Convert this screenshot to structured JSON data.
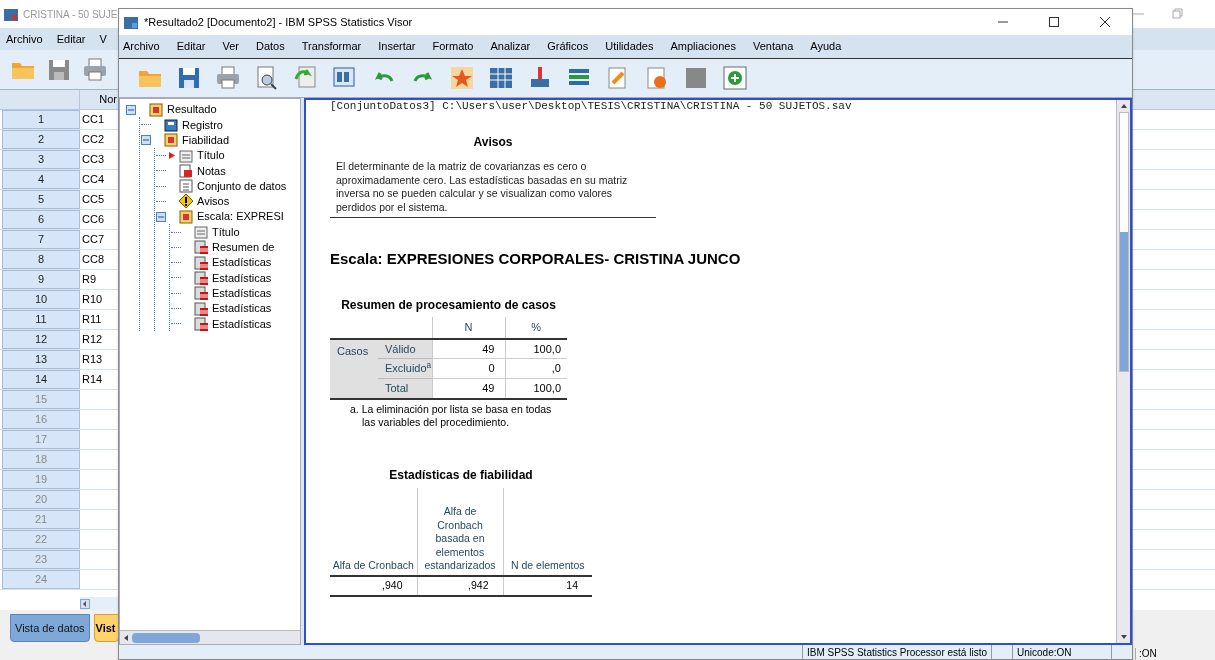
{
  "data_editor": {
    "title": "CRISTINA - 50 SUJE",
    "menu": [
      "Archivo",
      "Editar",
      "V"
    ],
    "column_header": "Nor",
    "rows": [
      {
        "number": "1",
        "name": "CC1"
      },
      {
        "number": "2",
        "name": "CC2"
      },
      {
        "number": "3",
        "name": "CC3"
      },
      {
        "number": "4",
        "name": "CC4"
      },
      {
        "number": "5",
        "name": "CC5"
      },
      {
        "number": "6",
        "name": "CC6"
      },
      {
        "number": "7",
        "name": "CC7"
      },
      {
        "number": "8",
        "name": "CC8"
      },
      {
        "number": "9",
        "name": "R9"
      },
      {
        "number": "10",
        "name": "R10"
      },
      {
        "number": "11",
        "name": "R11"
      },
      {
        "number": "12",
        "name": "R12"
      },
      {
        "number": "13",
        "name": "R13"
      },
      {
        "number": "14",
        "name": "R14"
      },
      {
        "number": "15"
      },
      {
        "number": "16"
      },
      {
        "number": "17"
      },
      {
        "number": "18"
      },
      {
        "number": "19"
      },
      {
        "number": "20"
      },
      {
        "number": "21"
      },
      {
        "number": "22"
      },
      {
        "number": "23"
      },
      {
        "number": "24"
      }
    ],
    "tabs": [
      {
        "label": "Vista de datos",
        "selected": false
      },
      {
        "label": "Vist",
        "selected": true
      }
    ],
    "status": ":ON"
  },
  "viewer": {
    "title": "*Resultado2 [Documento2] - IBM SPSS Statistics Visor",
    "menu": [
      "Archivo",
      "Editar",
      "Ver",
      "Datos",
      "Transformar",
      "Insertar",
      "Formato",
      "Analizar",
      "Gráficos",
      "Utilidades",
      "Ampliaciones",
      "Ventana",
      "Ayuda"
    ],
    "outline": [
      {
        "label": "Resultado",
        "kind": "heading",
        "expanded": true,
        "current": false,
        "children": [
          {
            "label": "Registro",
            "kind": "log",
            "current": false
          },
          {
            "label": "Fiabilidad",
            "kind": "heading",
            "expanded": true,
            "current": false,
            "children": [
              {
                "label": "Título",
                "kind": "title",
                "current": true
              },
              {
                "label": "Notas",
                "kind": "notes",
                "current": false
              },
              {
                "label": "Conjunto de datos",
                "kind": "dataset",
                "current": false
              },
              {
                "label": "Avisos",
                "kind": "warning",
                "current": false
              },
              {
                "label": "Escala: EXPRESI",
                "kind": "heading",
                "expanded": true,
                "current": false,
                "children": [
                  {
                    "label": "Título",
                    "kind": "title",
                    "current": false
                  },
                  {
                    "label": "Resumen de",
                    "kind": "table",
                    "current": false
                  },
                  {
                    "label": "Estadísticas",
                    "kind": "table",
                    "current": false
                  },
                  {
                    "label": "Estadísticas",
                    "kind": "table",
                    "current": false
                  },
                  {
                    "label": "Estadísticas",
                    "kind": "table",
                    "current": false
                  },
                  {
                    "label": "Estadísticas",
                    "kind": "table",
                    "current": false
                  },
                  {
                    "label": "Estadísticas",
                    "kind": "table",
                    "current": false
                  }
                ]
              }
            ]
          }
        ]
      }
    ],
    "content": {
      "dataset_path": "[ConjuntoDatos3] C:\\Users\\user\\Desktop\\TESIS\\CRISTINA\\CRISTINA - 50 SUJETOS.sav",
      "warnings": {
        "title": "Avisos",
        "text": "El determinante de la matriz de covarianzas es cero o aproximadamente cero. Las estadísticas basadas en su matriz inversa no se pueden calcular y se visualizan como valores perdidos por el sistema."
      },
      "scale_heading": "Escala: EXPRESIONES CORPORALES- CRISTINA JUNCO",
      "case_summary": {
        "title": "Resumen de procesamiento de casos",
        "columns": [
          "N",
          "%"
        ],
        "group": "Casos",
        "rows": [
          {
            "label": "Válido",
            "n": "49",
            "pct": "100,0"
          },
          {
            "label": "Excluido$^{a}$",
            "n": "0",
            "pct": ",0"
          },
          {
            "label": "Total",
            "n": "49",
            "pct": "100,0"
          }
        ],
        "footnote": "a. La eliminación por lista se basa en todas las variables del procedimiento."
      },
      "reliability": {
        "title": "Estadísticas de fiabilidad",
        "columns": [
          "Alfa de Cronbach",
          "Alfa de Cronbach basada en elementos estandarizados",
          "N de elementos"
        ],
        "values": [
          ",940",
          ",942",
          "14"
        ]
      }
    },
    "status_bar": [
      "IBM SPSS Statistics Processor está listo",
      "Unicode:ON"
    ]
  }
}
